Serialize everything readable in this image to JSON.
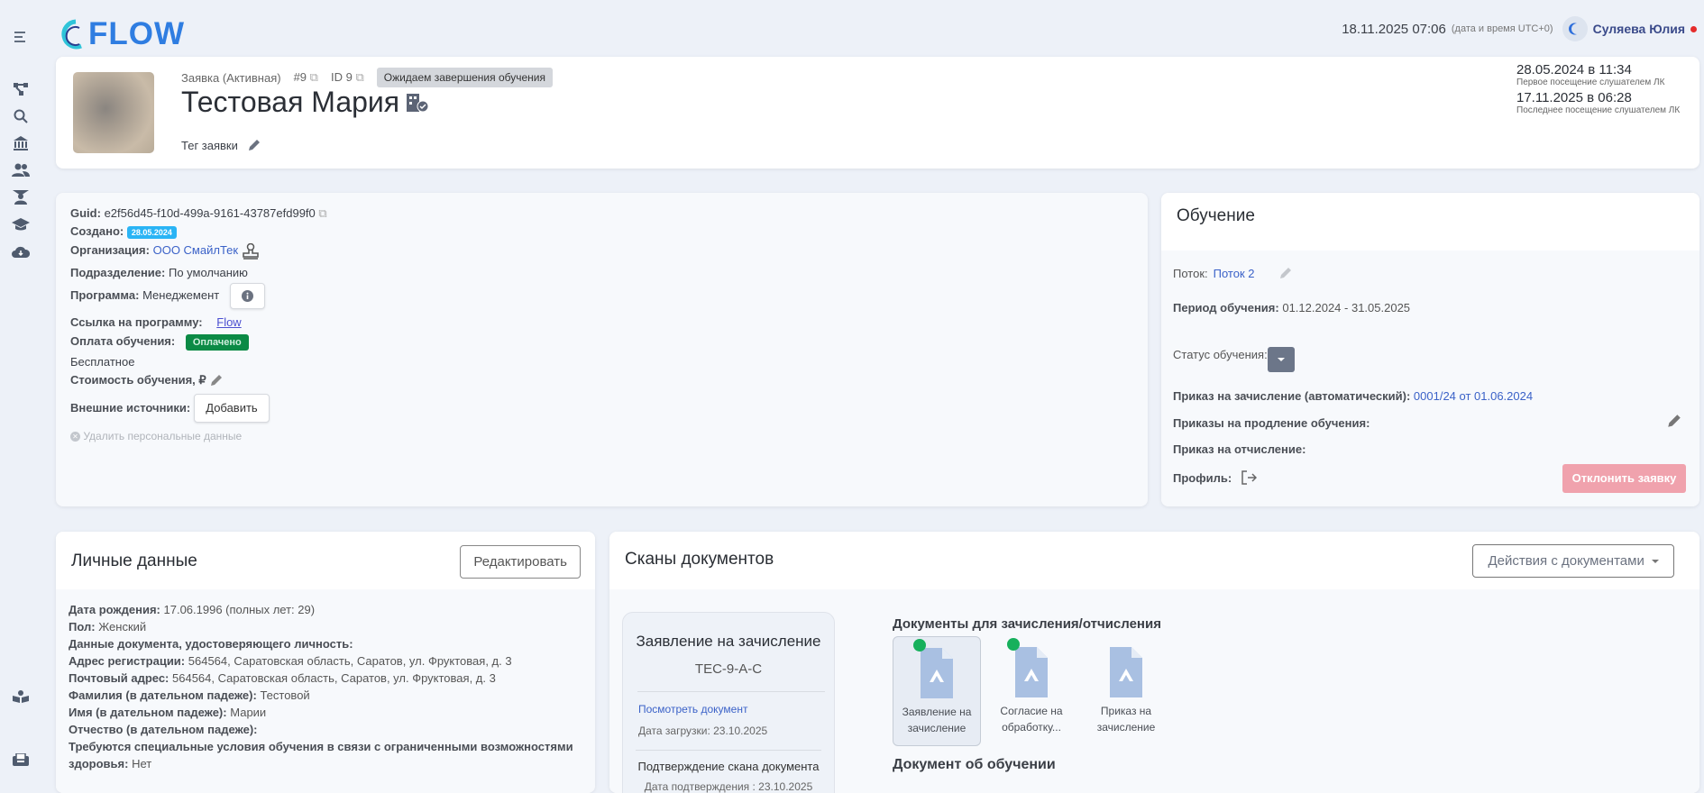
{
  "header": {
    "logo": "FLOW",
    "datetime": "18.11.2025 07:06",
    "tz_note": "(дата и время UTC+0)",
    "user": "Суляева Юлия"
  },
  "sidebar": {
    "icons": [
      "menu-icon",
      "sitemap-icon",
      "search-icon",
      "bank-icon",
      "users-icon",
      "teacher-icon",
      "graduation-cap-icon",
      "cloud-download-icon",
      "reader-icon",
      "inbox-icon"
    ]
  },
  "application": {
    "type": "Заявка (Активная)",
    "number": "#9",
    "id": "ID 9",
    "status_badge": "Ожидаем завершения обучения",
    "name": "Тестовая Мария",
    "tag_label": "Тег заявки",
    "first_visit": "28.05.2024 в 11:34",
    "first_visit_label": "Первое посещение слушателем ЛК",
    "last_visit": "17.11.2025 в 06:28",
    "last_visit_label": "Последнее посещение слушателем ЛК"
  },
  "info": {
    "guid_label": "Guid:",
    "guid": "e2f56d45-f10d-499a-9161-43787efd99f0",
    "created_label": "Создано:",
    "created": "28.05.2024",
    "org_label": "Организация:",
    "org": "ООО СмайлТек",
    "dept_label": "Подразделение:",
    "dept": "По умолчанию",
    "program_label": "Программа:",
    "program": "Менеджемент",
    "link_label": "Ссылка на программу:",
    "link": "Flow",
    "payment_label": "Оплата обучения:",
    "payment_badge": "Оплачено",
    "payment_type": "Бесплатное",
    "cost_label": "Стоимость обучения, ₽",
    "ext_label": "Внешние источники:",
    "ext_button": "Добавить",
    "delete_personal": "Удалить персональные данные"
  },
  "training": {
    "title": "Обучение",
    "stream_label": "Поток:",
    "stream": "Поток 2",
    "period_label": "Период обучения:",
    "period": "01.12.2024 - 31.05.2025",
    "status_label": "Статус обучения:",
    "enroll_order_label": "Приказ на зачисление (автоматический):",
    "enroll_order": "0001/24 от 01.06.2024",
    "extension_label": "Приказы на продление обучения:",
    "expel_label": "Приказ на отчисление:",
    "profile_label": "Профиль:",
    "reject_button": "Отклонить заявку"
  },
  "personal": {
    "title": "Личные данные",
    "edit_button": "Редактировать",
    "rows": [
      {
        "label": "Дата рождения:",
        "value": "17.06.1996 (полных лет: 29)"
      },
      {
        "label": "Пол:",
        "value": "Женский"
      },
      {
        "label": "Данные документа, удостоверяющего личность:",
        "value": ""
      },
      {
        "label": "Адрес регистрации:",
        "value": "564564, Саратовская область, Саратов, ул. Фруктовая, д. 3"
      },
      {
        "label": "Почтовый адрес:",
        "value": "564564, Саратовская область, Саратов, ул. Фруктовая, д. 3"
      },
      {
        "label": "Фамилия (в дательном падеже):",
        "value": "Тестовой"
      },
      {
        "label": "Имя (в дательном падеже):",
        "value": "Марии"
      },
      {
        "label": "Отчество (в дательном падеже):",
        "value": ""
      },
      {
        "label": "Требуются специальные условия обучения в связи с ограниченными возможностями здоровья:",
        "value": "Нет"
      }
    ]
  },
  "scans": {
    "title": "Сканы документов",
    "actions_button": "Действия с документами",
    "selected": {
      "title": "Заявление на зачисление",
      "code": "ТЕС-9-А-С",
      "view_link": "Посмотреть документ",
      "upload_date": "Дата загрузки: 23.10.2025",
      "confirm_title": "Подтверждение скана документа",
      "confirm_date": "Дата подтверждения : 23.10.2025"
    },
    "enroll_section": "Документы для зачисления/отчисления",
    "docs": [
      {
        "label": "Заявление на зачисление",
        "uploaded": true
      },
      {
        "label": "Согласие на обработку...",
        "uploaded": true
      },
      {
        "label": "Приказ на зачисление",
        "uploaded": false
      }
    ],
    "edu_section": "Документ об обучении"
  },
  "colors": {
    "accent": "#2f7de1",
    "paid": "#0b8a45",
    "created_badge": "#2ab4f5",
    "reject": "#f0a2ad",
    "dot": "#16b05c"
  }
}
